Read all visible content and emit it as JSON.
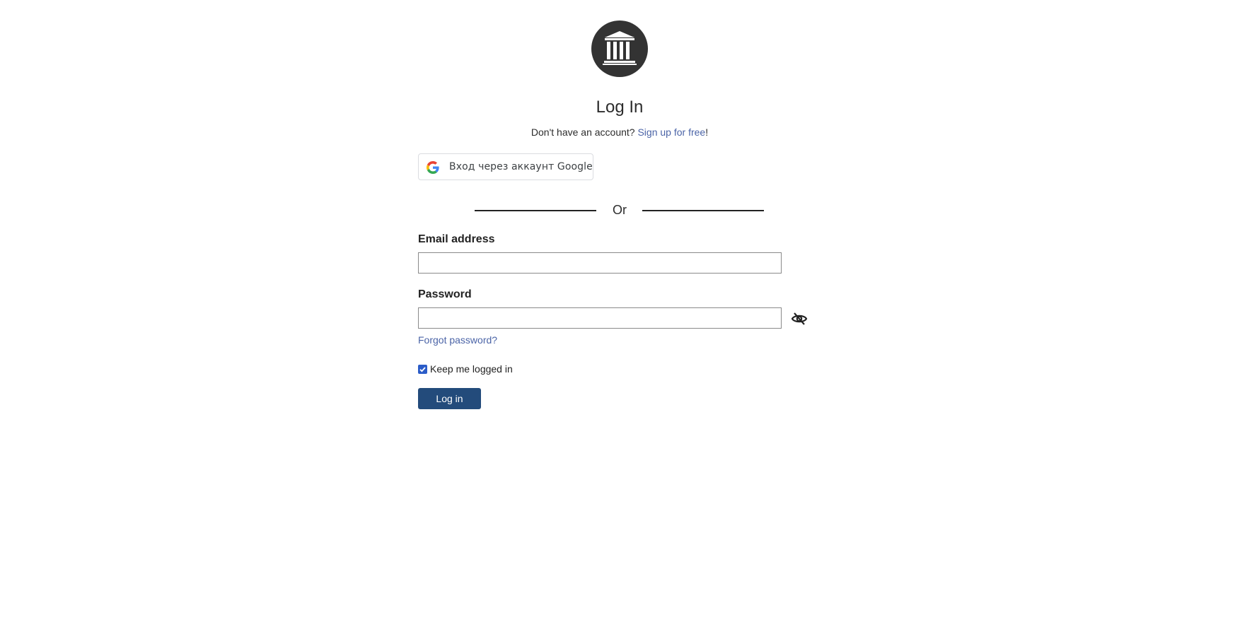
{
  "logo": {
    "icon": "archive-building-icon",
    "background": "#333333"
  },
  "header": {
    "title": "Log In"
  },
  "signup": {
    "prompt": "Don't have an account?",
    "link_label": "Sign up for free",
    "suffix": "!",
    "link_color": "#4b64a7"
  },
  "google_button": {
    "label": "Вход через аккаунт Google",
    "icon": "google-icon"
  },
  "divider": {
    "label": "Or"
  },
  "form": {
    "email": {
      "label": "Email address",
      "value": "",
      "placeholder": ""
    },
    "password": {
      "label": "Password",
      "value": "",
      "placeholder": "",
      "toggle_icon": "eye-slash-icon"
    },
    "forgot_label": "Forgot password?",
    "remember": {
      "label": "Keep me logged in",
      "checked": true
    },
    "submit_label": "Log in",
    "submit_color": "#234b7b"
  }
}
